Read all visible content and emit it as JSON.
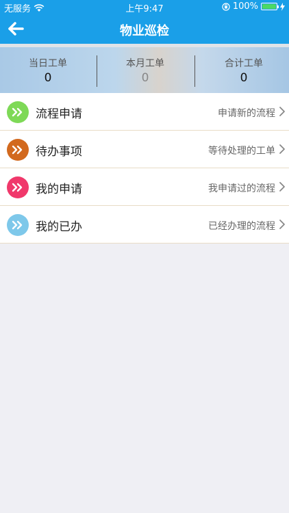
{
  "status_bar": {
    "carrier": "无服务",
    "time": "上午9:47",
    "battery": "100%",
    "battery_level": 1.0
  },
  "nav": {
    "title": "物业巡检",
    "back_icon": "back-arrow-icon"
  },
  "stats": [
    {
      "label": "当日工单",
      "value": "0"
    },
    {
      "label": "本月工单",
      "value": "0"
    },
    {
      "label": "合计工单",
      "value": "0"
    }
  ],
  "menu": [
    {
      "title": "流程申请",
      "desc": "申请新的流程",
      "color": "#7ed957"
    },
    {
      "title": "待办事项",
      "desc": "等待处理的工单",
      "color": "#d2691e"
    },
    {
      "title": "我的申请",
      "desc": "我申请过的流程",
      "color": "#f0386b"
    },
    {
      "title": "我的已办",
      "desc": "已经办理的流程",
      "color": "#7ec8ea"
    }
  ],
  "colors": {
    "primary": "#1a9fe8",
    "background": "#efeff4"
  }
}
